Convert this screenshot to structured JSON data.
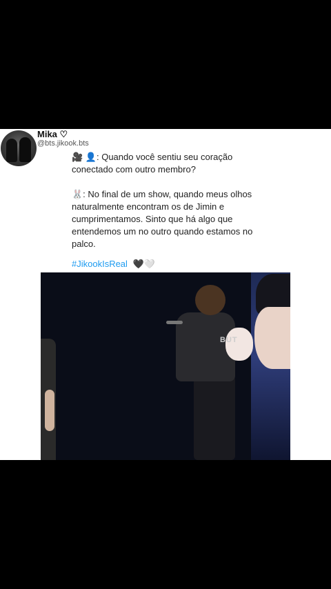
{
  "account": {
    "username": "Mika ♡",
    "handle": "@bts.jikook.bts"
  },
  "tweet": {
    "question": "🎥 👤: Quando você sentiu seu coração conectado com outro membro?",
    "answer": "🐰: No final de um show, quando meus olhos naturalmente encontram os de Jimin e cumprimentamos. Sinto que há algo que entendemos um no outro quando estamos no palco.",
    "hashtag": "#JikookIsReal",
    "hearts": "🖤🤍"
  },
  "photo": {
    "shirt_text": "BUT"
  },
  "colors": {
    "background": "#000000",
    "card": "#ffffff",
    "hashtag": "#1d9bf0"
  }
}
